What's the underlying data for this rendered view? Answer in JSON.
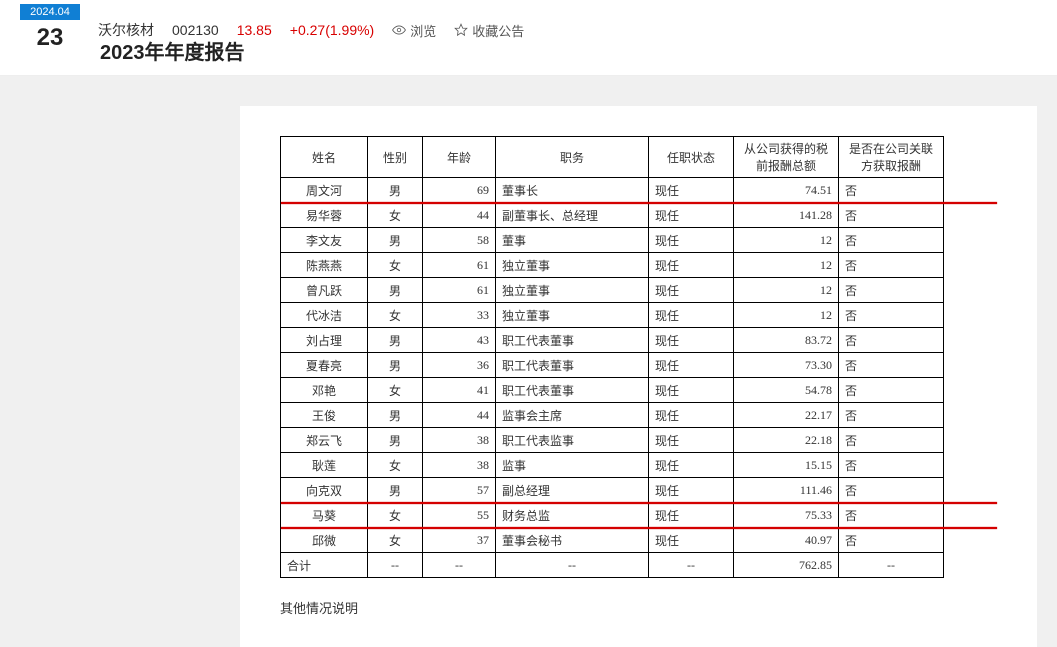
{
  "header": {
    "date_ym": "2024.04",
    "date_day": "23",
    "stock_name": "沃尔核材",
    "stock_code": "002130",
    "price": "13.85",
    "change": "+0.27(1.99%)",
    "browse_label": "浏览",
    "fav_label": "收藏公告",
    "report_title": "2023年年度报告"
  },
  "table": {
    "headers": {
      "name": "姓名",
      "gender": "性别",
      "age": "年龄",
      "position": "职务",
      "status": "任职状态",
      "pay": "从公司获得的税前报酬总额",
      "related": "是否在公司关联方获取报酬"
    },
    "rows": [
      {
        "name": "周文河",
        "gender": "男",
        "age": "69",
        "position": "董事长",
        "status": "现任",
        "pay": "74.51",
        "related": "否",
        "hl": true
      },
      {
        "name": "易华蓉",
        "gender": "女",
        "age": "44",
        "position": "副董事长、总经理",
        "status": "现任",
        "pay": "141.28",
        "related": "否",
        "hl": false
      },
      {
        "name": "李文友",
        "gender": "男",
        "age": "58",
        "position": "董事",
        "status": "现任",
        "pay": "12",
        "related": "否",
        "hl": false
      },
      {
        "name": "陈燕燕",
        "gender": "女",
        "age": "61",
        "position": "独立董事",
        "status": "现任",
        "pay": "12",
        "related": "否",
        "hl": false
      },
      {
        "name": "曾凡跃",
        "gender": "男",
        "age": "61",
        "position": "独立董事",
        "status": "现任",
        "pay": "12",
        "related": "否",
        "hl": false
      },
      {
        "name": "代冰洁",
        "gender": "女",
        "age": "33",
        "position": "独立董事",
        "status": "现任",
        "pay": "12",
        "related": "否",
        "hl": false
      },
      {
        "name": "刘占理",
        "gender": "男",
        "age": "43",
        "position": "职工代表董事",
        "status": "现任",
        "pay": "83.72",
        "related": "否",
        "hl": false
      },
      {
        "name": "夏春亮",
        "gender": "男",
        "age": "36",
        "position": "职工代表董事",
        "status": "现任",
        "pay": "73.30",
        "related": "否",
        "hl": false
      },
      {
        "name": "邓艳",
        "gender": "女",
        "age": "41",
        "position": "职工代表董事",
        "status": "现任",
        "pay": "54.78",
        "related": "否",
        "hl": false
      },
      {
        "name": "王俊",
        "gender": "男",
        "age": "44",
        "position": "监事会主席",
        "status": "现任",
        "pay": "22.17",
        "related": "否",
        "hl": false
      },
      {
        "name": "郑云飞",
        "gender": "男",
        "age": "38",
        "position": "职工代表监事",
        "status": "现任",
        "pay": "22.18",
        "related": "否",
        "hl": false
      },
      {
        "name": "耿莲",
        "gender": "女",
        "age": "38",
        "position": "监事",
        "status": "现任",
        "pay": "15.15",
        "related": "否",
        "hl": false
      },
      {
        "name": "向克双",
        "gender": "男",
        "age": "57",
        "position": "副总经理",
        "status": "现任",
        "pay": "111.46",
        "related": "否",
        "hl": true
      },
      {
        "name": "马葵",
        "gender": "女",
        "age": "55",
        "position": "财务总监",
        "status": "现任",
        "pay": "75.33",
        "related": "否",
        "hl": true
      },
      {
        "name": "邱微",
        "gender": "女",
        "age": "37",
        "position": "董事会秘书",
        "status": "现任",
        "pay": "40.97",
        "related": "否",
        "hl": false
      }
    ],
    "total": {
      "label": "合计",
      "dash": "--",
      "pay": "762.85"
    }
  },
  "footer_note": "其他情况说明"
}
